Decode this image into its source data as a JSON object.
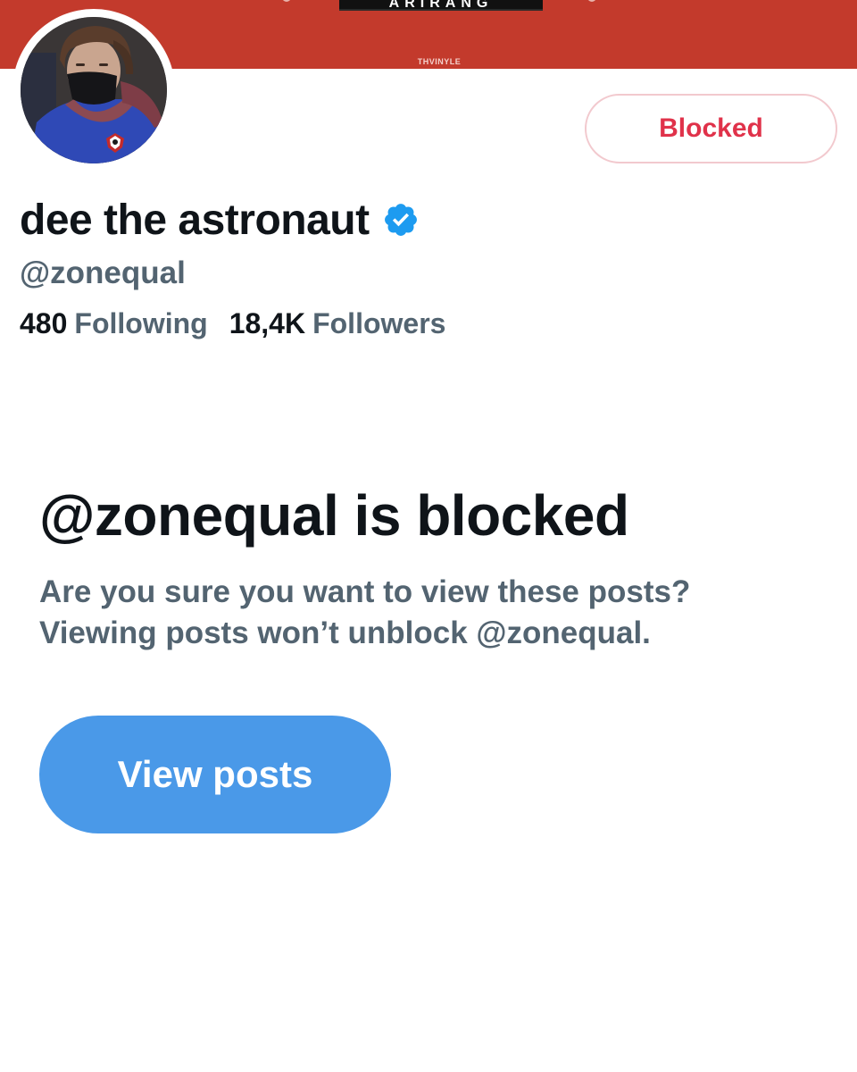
{
  "banner": {
    "logo_text": "ARIRANG",
    "caption": "THVINYLE"
  },
  "profile": {
    "display_name": "dee the astronaut",
    "handle": "@zonequal",
    "verified": true,
    "following_count": "480",
    "following_label": "Following",
    "followers_count": "18,4K",
    "followers_label": "Followers"
  },
  "actions": {
    "blocked_label": "Blocked",
    "view_posts_label": "View posts"
  },
  "notice": {
    "title": "@zonequal is blocked",
    "line1": "Are you sure you want to view these posts?",
    "line2": "Viewing posts won’t unblock @zonequal."
  },
  "colors": {
    "banner": "#c33a2c",
    "blocked_text": "#e0324a",
    "primary_text": "#0f1419",
    "secondary_text": "#536471",
    "view_button": "#4a99e8",
    "verified_badge": "#1d9bf0"
  },
  "icons": {
    "verified": "verified-badge-icon"
  }
}
